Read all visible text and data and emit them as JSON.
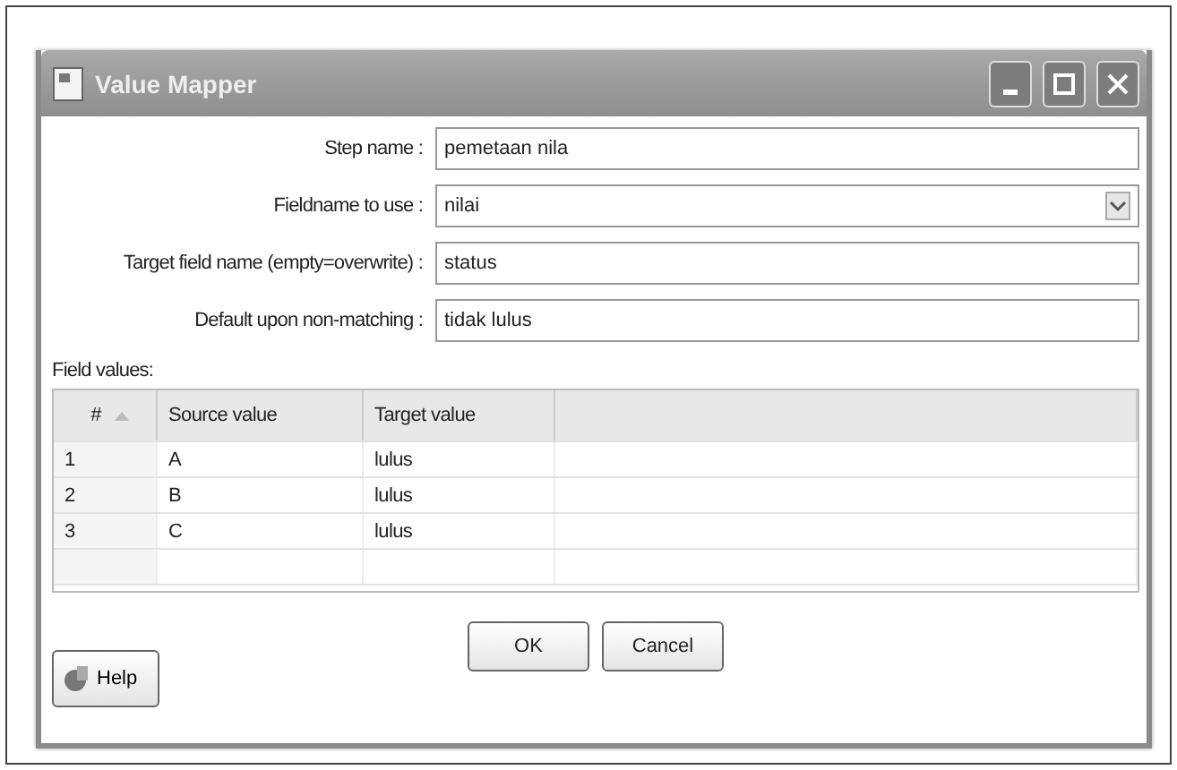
{
  "window": {
    "title": "Value Mapper"
  },
  "form": [
    {
      "label": "Step name :",
      "value": "pemetaan nila",
      "kind": "text"
    },
    {
      "label": "Fieldname to use :",
      "value": "nilai",
      "kind": "dropdown"
    },
    {
      "label": "Target field name (empty=overwrite) :",
      "value": "status",
      "kind": "text"
    },
    {
      "label": "Default upon non-matching :",
      "value": "tidak lulus",
      "kind": "text"
    }
  ],
  "field_values": {
    "label": "Field values:",
    "columns": [
      "#",
      "Source value",
      "Target value"
    ],
    "rows": [
      [
        "1",
        "A",
        "lulus"
      ],
      [
        "2",
        "B",
        "lulus"
      ],
      [
        "3",
        "C",
        "lulus"
      ]
    ]
  },
  "buttons": [
    "OK",
    "Cancel"
  ],
  "help_button": "Help"
}
